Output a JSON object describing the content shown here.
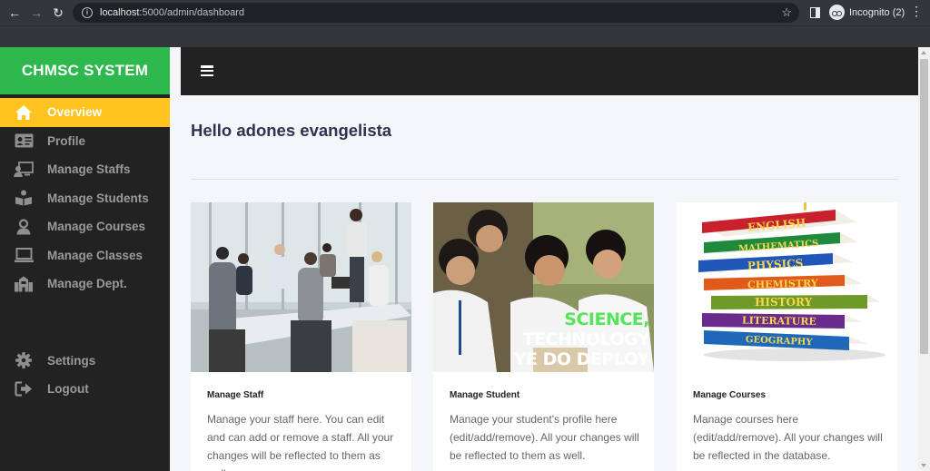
{
  "browser": {
    "url_host": "localhost",
    "url_rest": ":5000/admin/dashboard",
    "profile_label": "Incognito (2)"
  },
  "brand": {
    "title": "CHMSC SYSTEM",
    "color": "#2eb84e"
  },
  "sidebar": {
    "items": [
      {
        "label": "Overview",
        "icon": "home-icon",
        "active": true
      },
      {
        "label": "Profile",
        "icon": "id-card-icon"
      },
      {
        "label": "Manage Staffs",
        "icon": "staff-icon"
      },
      {
        "label": "Manage Students",
        "icon": "students-icon"
      },
      {
        "label": "Manage Courses",
        "icon": "course-icon"
      },
      {
        "label": "Manage Classes",
        "icon": "laptop-icon"
      },
      {
        "label": "Manage Dept.",
        "icon": "building-icon"
      }
    ],
    "bottom_items": [
      {
        "label": "Settings",
        "icon": "gear-icon"
      },
      {
        "label": "Logout",
        "icon": "logout-icon"
      }
    ],
    "active_color": "#ffc31f"
  },
  "main": {
    "greeting": "Hello adones evangelista",
    "cards": [
      {
        "title": "Manage Staff",
        "description": "Manage your staff here. You can edit and can add or remove a staff. All your changes will be reflected to them as well.",
        "image": "staff-meeting-photo"
      },
      {
        "title": "Manage Student",
        "description": "Manage your student's profile here (edit/add/remove). All your changes will be reflected to them as well.",
        "image": "students-photo",
        "image_text_line1a": "SCIENCE,",
        "image_text_line1b": " TECHNOLOGY",
        "image_text_line2": "YE DO DEPLOY"
      },
      {
        "title": "Manage Courses",
        "description": "Manage courses here (edit/add/remove). All your changes will be reflected in the database.",
        "image": "books-stack-illustration",
        "books": [
          {
            "label": "ENGLISH",
            "color": "#c8202c"
          },
          {
            "label": "MATHEMATICS",
            "color": "#1f8a3c"
          },
          {
            "label": "PHYSICS",
            "color": "#1f56b8"
          },
          {
            "label": "CHEMISTRY",
            "color": "#e05a1b"
          },
          {
            "label": "HISTORY",
            "color": "#6f9a2a"
          },
          {
            "label": "LITERATURE",
            "color": "#6a2c8c"
          },
          {
            "label": "GEOGRAPHY",
            "color": "#1f68b8"
          }
        ]
      }
    ]
  }
}
